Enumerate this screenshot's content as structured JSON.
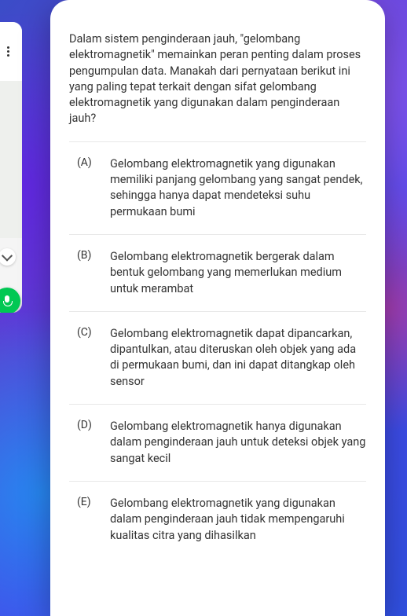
{
  "question": "Dalam sistem penginderaan jauh, \"gelombang elektromagnetik\" memainkan peran penting dalam proses pengumpulan data. Manakah dari pernyataan berikut ini yang paling tepat terkait dengan sifat gelombang elektromagnetik yang digunakan dalam penginderaan jauh?",
  "options": {
    "a": {
      "label": "(A)",
      "text": "Gelombang elektromagnetik yang digunakan memiliki panjang gelombang yang sangat pendek, sehingga hanya dapat mendeteksi suhu permukaan bumi"
    },
    "b": {
      "label": "(B)",
      "text": "Gelombang elektromagnetik bergerak dalam bentuk gelombang yang memerlukan medium untuk merambat"
    },
    "c": {
      "label": "(C)",
      "text": "Gelombang elektromagnetik dapat dipancarkan, dipantulkan, atau diteruskan oleh objek yang ada di permukaan bumi, dan ini dapat ditangkap oleh sensor"
    },
    "d": {
      "label": "(D)",
      "text": "Gelombang elektromagnetik hanya digunakan dalam penginderaan jauh untuk deteksi objek yang sangat kecil"
    },
    "e": {
      "label": "(E)",
      "text": "Gelombang elektromagnetik yang digunakan dalam penginderaan jauh tidak mempengaruhi kualitas citra yang dihasilkan"
    }
  }
}
